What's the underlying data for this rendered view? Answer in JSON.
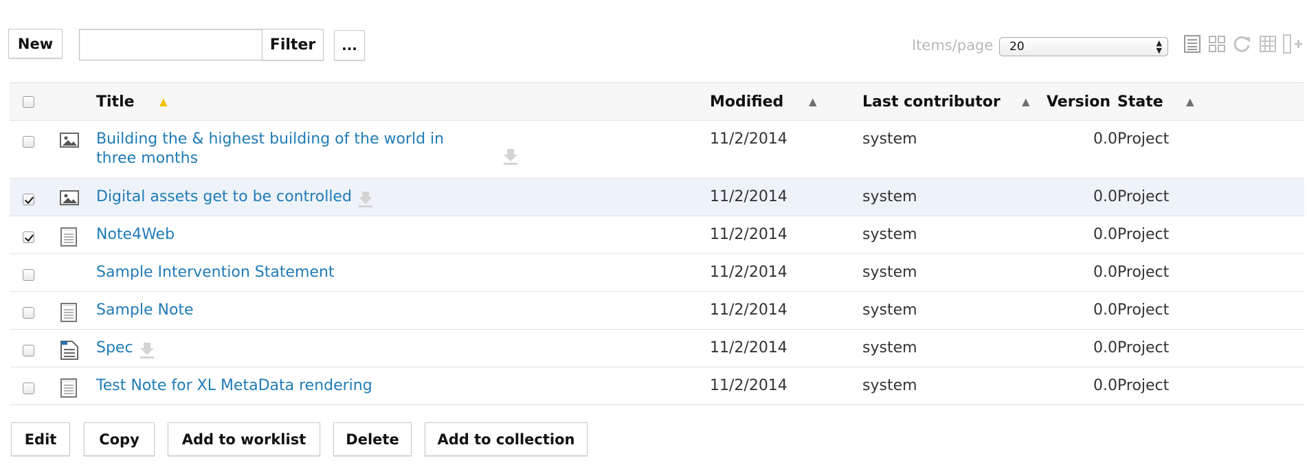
{
  "toolbar": {
    "new_label": "New",
    "filter_value": "",
    "filter_label": "Filter",
    "more_label": "...",
    "items_per_page_label": "Items/page",
    "items_per_page_value": "20"
  },
  "columns": {
    "title": "Title",
    "modified": "Modified",
    "last_contributor": "Last contributor",
    "version": "Version",
    "state": "State"
  },
  "rows": [
    {
      "title": "Building the & highest building of the world in three months",
      "modified": "11/2/2014",
      "contributor": "system",
      "version": "0.0",
      "state": "Project",
      "checked": false,
      "icon": "image-icon",
      "download": true
    },
    {
      "title": "Digital assets get to be controlled",
      "modified": "11/2/2014",
      "contributor": "system",
      "version": "0.0",
      "state": "Project",
      "checked": true,
      "icon": "image-icon",
      "download": true
    },
    {
      "title": "Note4Web",
      "modified": "11/2/2014",
      "contributor": "system",
      "version": "0.0",
      "state": "Project",
      "checked": true,
      "icon": "note-icon",
      "download": false
    },
    {
      "title": "Sample Intervention Statement",
      "modified": "11/2/2014",
      "contributor": "system",
      "version": "0.0",
      "state": "Project",
      "checked": false,
      "icon": "",
      "download": false
    },
    {
      "title": "Sample Note",
      "modified": "11/2/2014",
      "contributor": "system",
      "version": "0.0",
      "state": "Project",
      "checked": false,
      "icon": "note-icon",
      "download": false
    },
    {
      "title": "Spec",
      "modified": "11/2/2014",
      "contributor": "system",
      "version": "0.0",
      "state": "Project",
      "checked": false,
      "icon": "file-icon",
      "download": true
    },
    {
      "title": "Test Note for XL MetaData rendering",
      "modified": "11/2/2014",
      "contributor": "system",
      "version": "0.0",
      "state": "Project",
      "checked": false,
      "icon": "note-icon",
      "download": false
    }
  ],
  "actions": {
    "edit": "Edit",
    "copy": "Copy",
    "add_to_worklist": "Add to worklist",
    "delete": "Delete",
    "add_to_collection": "Add to collection"
  },
  "colors": {
    "link": "#1f7bb6",
    "active_sort": "#f2c200",
    "inactive_sort": "#6e6e6e",
    "selected_row": "#eef3f9"
  }
}
